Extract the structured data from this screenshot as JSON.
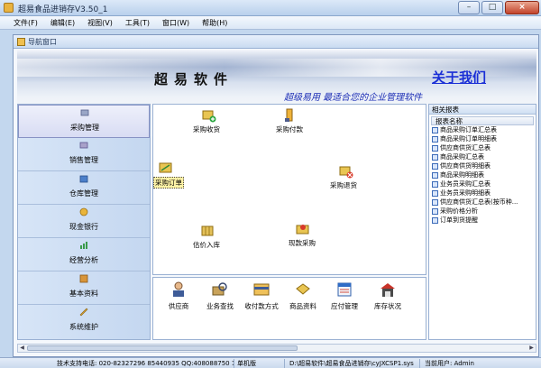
{
  "window": {
    "title": "超易食品进销存V3.50_1",
    "min": "–",
    "max": "□",
    "close": "×"
  },
  "menu": [
    {
      "label": "文件(F)"
    },
    {
      "label": "编辑(E)"
    },
    {
      "label": "视图(V)"
    },
    {
      "label": "工具(T)"
    },
    {
      "label": "窗口(W)"
    },
    {
      "label": "帮助(H)"
    }
  ],
  "child_window": {
    "title": "导航窗口"
  },
  "banner": {
    "brand": "超易软件",
    "about": "关于我们",
    "slogan": "超级易用  最适合您的企业管理软件"
  },
  "nav": [
    {
      "label": "采购管理",
      "icon": "cart-icon"
    },
    {
      "label": "销售管理",
      "icon": "sales-icon"
    },
    {
      "label": "仓库管理",
      "icon": "warehouse-icon"
    },
    {
      "label": "现金银行",
      "icon": "cash-icon"
    },
    {
      "label": "经营分析",
      "icon": "chart-icon"
    },
    {
      "label": "基本资料",
      "icon": "book-icon"
    },
    {
      "label": "系统维护",
      "icon": "wrench-icon"
    }
  ],
  "workflow": [
    {
      "label": "采购收货",
      "icon": "receive-icon"
    },
    {
      "label": "采购付款",
      "icon": "payment-icon"
    },
    {
      "label": "采购订单",
      "icon": "order-icon"
    },
    {
      "label": "采购退货",
      "icon": "return-icon"
    },
    {
      "label": "估价入库",
      "icon": "estimate-icon"
    },
    {
      "label": "现款采购",
      "icon": "cash-purchase-icon"
    }
  ],
  "tools": [
    {
      "label": "供应商",
      "icon": "supplier-icon"
    },
    {
      "label": "业务查找",
      "icon": "search-icon"
    },
    {
      "label": "收付款方式",
      "icon": "pay-method-icon"
    },
    {
      "label": "商品资料",
      "icon": "goods-icon"
    },
    {
      "label": "应付管理",
      "icon": "payable-icon"
    },
    {
      "label": "库存状况",
      "icon": "stock-icon"
    }
  ],
  "reports": {
    "title": "相关报表",
    "column": "报表名称",
    "items": [
      "商品采购订单汇总表",
      "商品采购订单明细表",
      "供应商供货汇总表",
      "商品采购汇总表",
      "供应商供货明细表",
      "商品采购明细表",
      "业务员采购汇总表",
      "业务员采购明细表",
      "供应商供货汇总表(按币种...",
      "采购价格分析",
      "订单到货提醒"
    ]
  },
  "status": {
    "support": "技术支持电话: 020-82327296 85440935 QQ:408088750 19669",
    "edition": "单机版",
    "path": "D:\\超易软件\\超易食品进销存\\cyJXCSP1.sys",
    "user": "当前用户: Admin"
  },
  "colors": {
    "accent": "#1a2fd6",
    "slogan": "#1b2db5",
    "nav_bg": "#c4d7f0"
  }
}
